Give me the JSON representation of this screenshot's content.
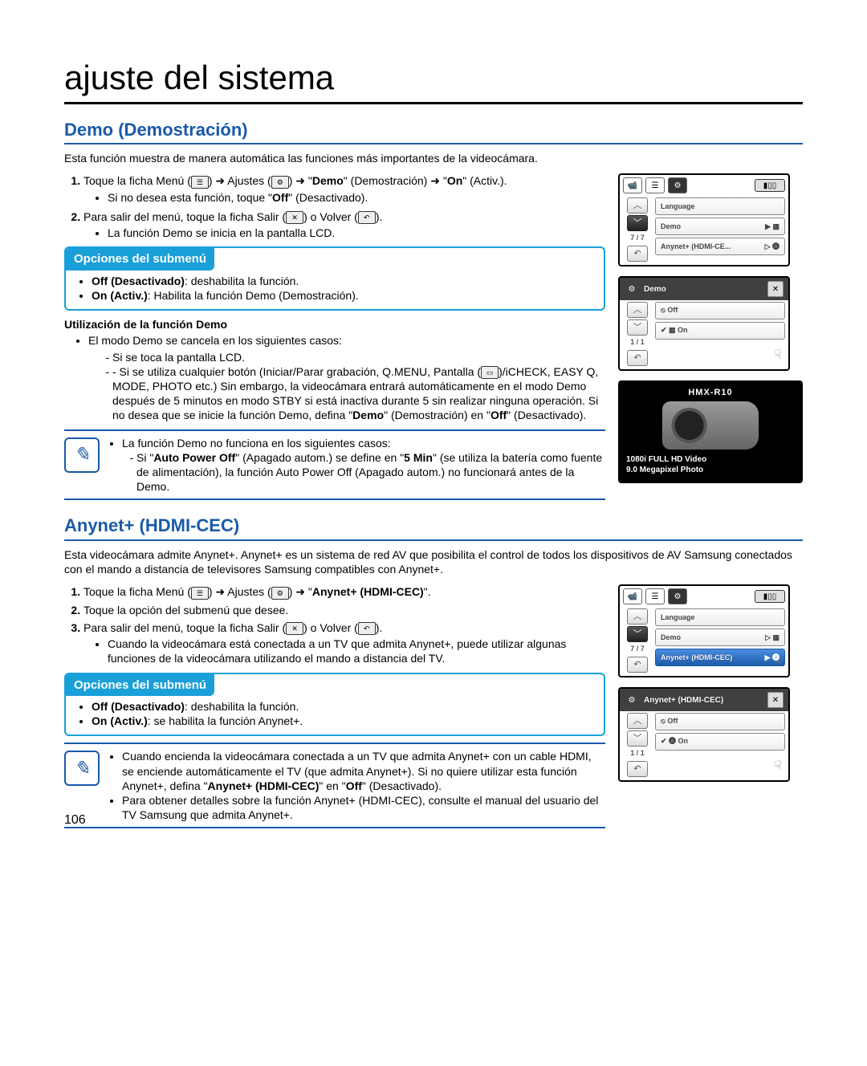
{
  "pageNumber": "106",
  "pageTitle": "ajuste del sistema",
  "demo": {
    "heading": "Demo (Demostración)",
    "intro": "Esta función muestra de manera automática las funciones más importantes de la videocámara.",
    "step1a": "Toque la ficha Menú (",
    "step1b": ") ➜ Ajustes (",
    "step1c": ") ➜ \"",
    "step1bold": "Demo",
    "step1d": "\" (Demostración) ➜ \"",
    "step1bold2": "On",
    "step1e": "\" (Activ.).",
    "step1bullet": "Si no desea esta función, toque \"",
    "step1bulletBold": "Off",
    "step1bulletEnd": "\" (Desactivado).",
    "step2a": "Para salir del menú, toque la ficha Salir (",
    "step2b": ") o Volver (",
    "step2c": ").",
    "step2bullet": "La función Demo se inicia en la pantalla LCD.",
    "submenuTitle": "Opciones del submenú",
    "submenuOffBold": "Off (Desactivado)",
    "submenuOff": ": deshabilita la función.",
    "submenuOnBold": "On (Activ.)",
    "submenuOn": ": Habilita la función Demo (Demostración).",
    "usageTitle": "Utilización de la función Demo",
    "usageIntro": "El modo Demo se cancela en los siguientes casos:",
    "usageDash1": "Si se toca la pantalla LCD.",
    "usageDash2a": "- Si se utiliza cualquier botón (Iniciar/Parar grabación, Q.MENU, Pantalla (",
    "usageDash2b": ")/iCHECK, EASY Q, MODE, PHOTO etc.) Sin embargo, la videocámara entrará automáticamente en el modo Demo después de 5 minutos en modo STBY si está inactiva durante 5 sin realizar ninguna operación. Si no desea que se inicie la función Demo, defina \"",
    "usageDash2bold": "Demo",
    "usageDash2c": "\" (Demostración) en \"",
    "usageDash2bold2": "Off",
    "usageDash2d": "\" (Desactivado).",
    "noteIntro": "La función Demo no funciona en los siguientes casos:",
    "noteDash1a": "Si \"",
    "noteDash1bold1": "Auto Power Off",
    "noteDash1b": "\" (Apagado autom.) se define en \"",
    "noteDash1bold2": "5 Min",
    "noteDash1c": "\" (se utiliza la batería como fuente de alimentación), la función Auto Power Off (Apagado autom.) no funcionará antes de la Demo."
  },
  "anynet": {
    "heading": "Anynet+ (HDMI-CEC)",
    "intro": "Esta videocámara admite Anynet+. Anynet+ es un sistema de red AV que posibilita el control de todos los dispositivos de AV Samsung conectados con el mando a distancia de televisores Samsung compatibles con Anynet+.",
    "step1a": "Toque la ficha Menú (",
    "step1b": ") ➜ Ajustes (",
    "step1c": ") ➜ \"",
    "step1bold": "Anynet+ (HDMI-CEC)",
    "step1d": "\".",
    "step2": "Toque la opción del submenú que desee.",
    "step3a": "Para salir del menú, toque la ficha Salir (",
    "step3b": ") o Volver (",
    "step3c": ").",
    "step3bullet": "Cuando la videocámara está conectada a un TV que admita Anynet+, puede utilizar algunas funciones de la videocámara utilizando el mando a distancia del TV.",
    "submenuTitle": "Opciones del submenú",
    "submenuOffBold": "Off (Desactivado)",
    "submenuOff": ": deshabilita la función.",
    "submenuOnBold": "On (Activ.)",
    "submenuOn": ": se habilita la función Anynet+.",
    "note1a": "Cuando encienda la videocámara conectada a un TV que admita Anynet+ con un cable HDMI, se enciende automáticamente el TV (que admita Anynet+). Si no quiere utilizar esta función Anynet+, defina \"",
    "note1bold": "Anynet+ (HDMI-CEC)",
    "note1b": "\" en \"",
    "note1bold2": "Off",
    "note1c": "\" (Desactivado).",
    "note2": "Para obtener detalles sobre la función Anynet+ (HDMI-CEC), consulte el manual del usuario del TV Samsung que admita Anynet+."
  },
  "screens": {
    "page77": "7 / 7",
    "page11": "1 / 1",
    "language": "Language",
    "demo": "Demo",
    "anynetItem": "Anynet+ (HDMI-CE...",
    "anynetItemFull": "Anynet+ (HDMI-CEC)",
    "off": "Off",
    "on": "On"
  },
  "promo": {
    "model": "HMX-R10",
    "line1": "1080i FULL HD Video",
    "line2": "9.0 Megapixel Photo"
  }
}
